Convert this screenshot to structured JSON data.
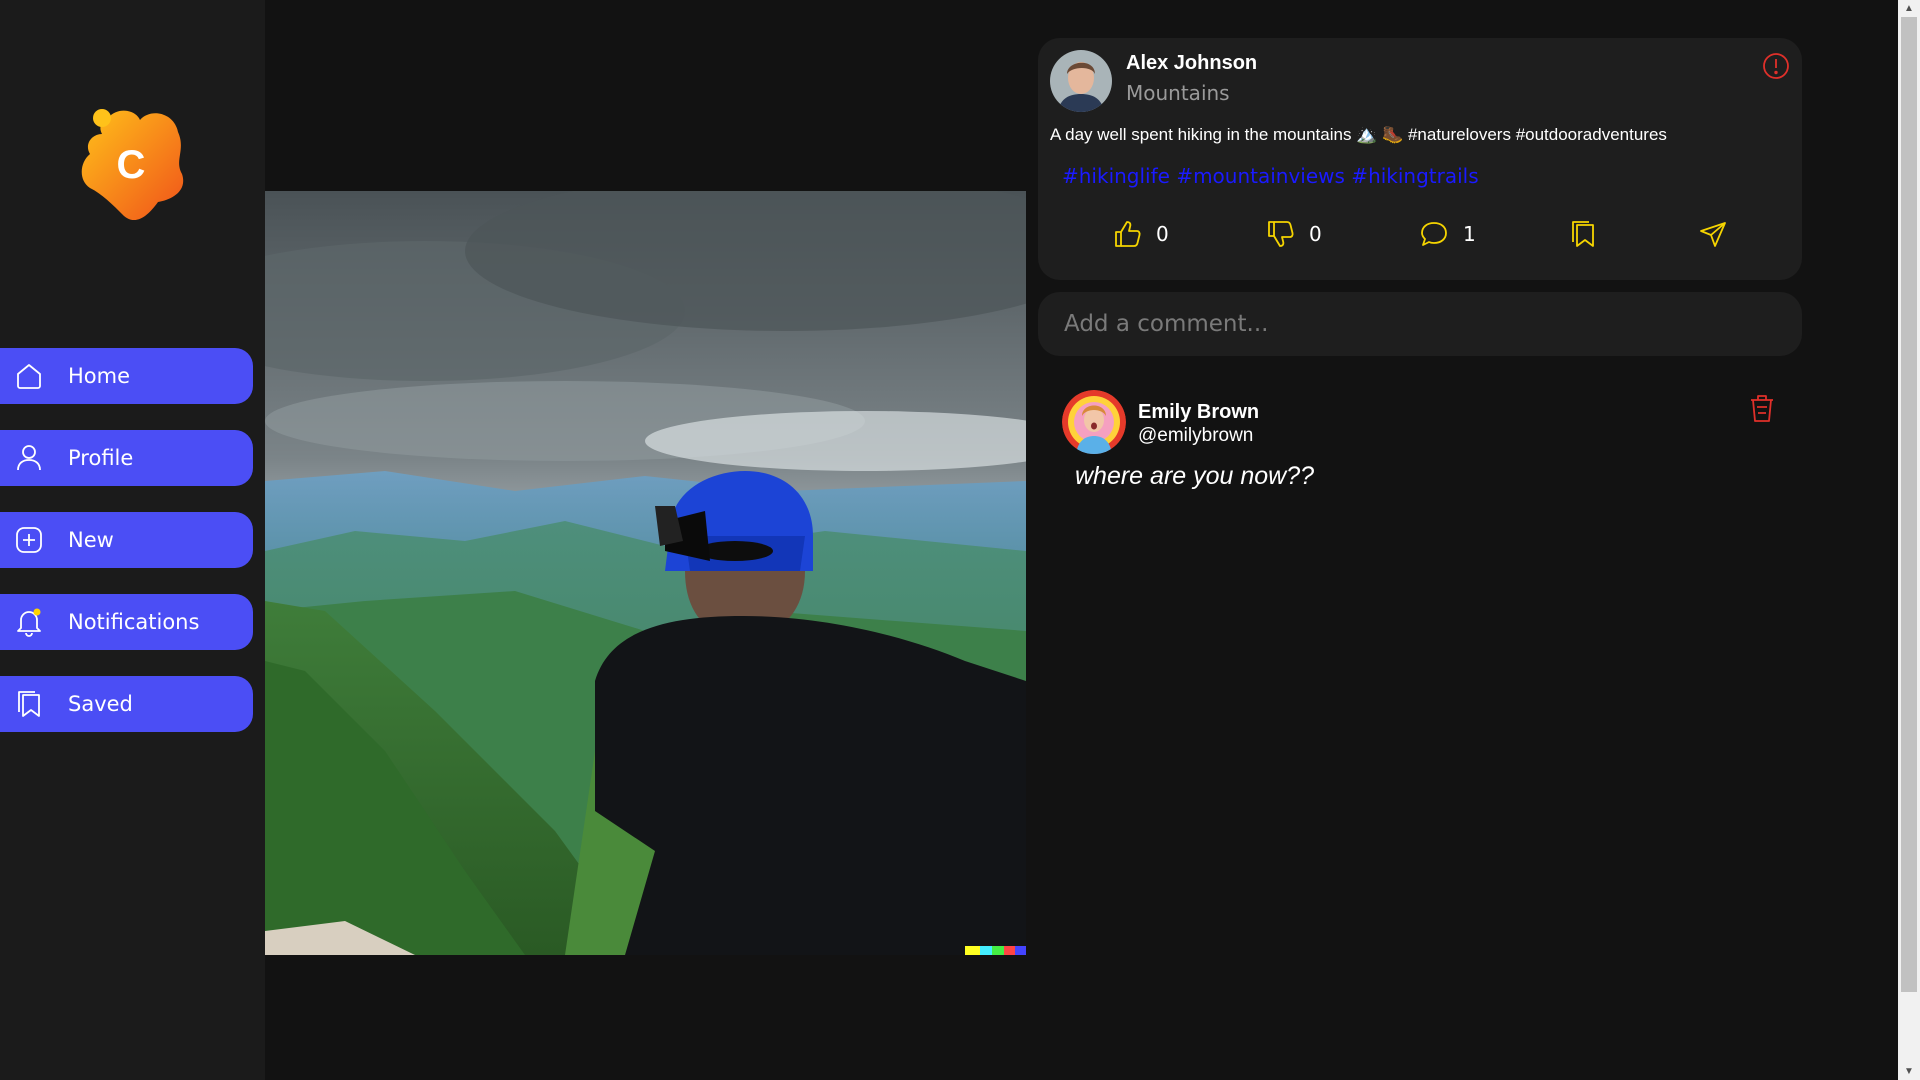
{
  "nav": {
    "items": [
      {
        "label": "Home",
        "icon": "home-icon"
      },
      {
        "label": "Profile",
        "icon": "user-icon"
      },
      {
        "label": "New",
        "icon": "plus-square-icon"
      },
      {
        "label": "Notifications",
        "icon": "bell-icon"
      },
      {
        "label": "Saved",
        "icon": "bookmarks-icon"
      }
    ]
  },
  "post": {
    "author_name": "Alex Johnson",
    "location": "Mountains",
    "caption": "A day well spent hiking in the mountains 🏔️ 🥾 #naturelovers #outdooradventures",
    "hashtags": "#hikinglife #mountainviews #hikingtrails",
    "likes": "0",
    "dislikes": "0",
    "comments": "1"
  },
  "comment_input": {
    "placeholder": "Add a comment..."
  },
  "comment": {
    "name": "Emily Brown",
    "handle": "@emilybrown",
    "text": "where are you now??"
  },
  "colors": {
    "accent": "#4b4ef5",
    "action_icon": "#f5d400",
    "danger": "#e0302a",
    "hashtag": "#1a1aff"
  }
}
